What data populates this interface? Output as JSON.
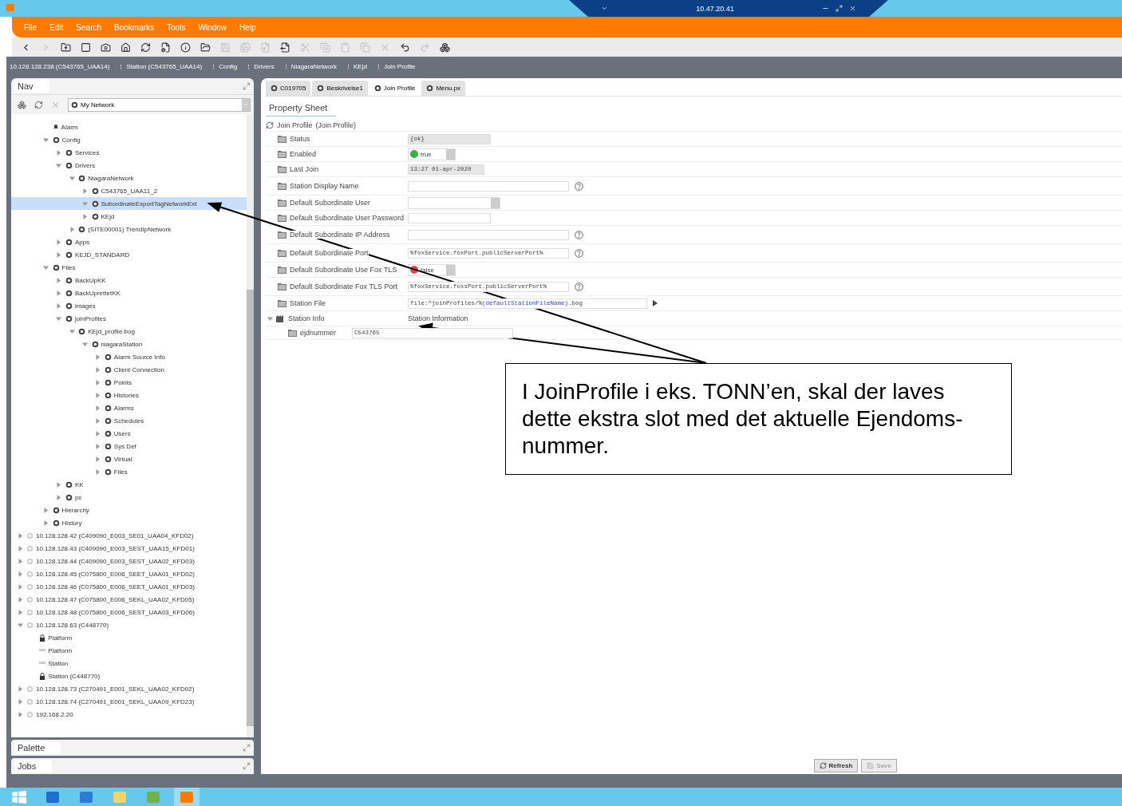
{
  "remote_bar": {
    "address": "10.47.20.41"
  },
  "menu": [
    "File",
    "Edit",
    "Search",
    "Bookmarks",
    "Tools",
    "Window",
    "Help"
  ],
  "toolbar": [
    {
      "disabled": false
    },
    {
      "disabled": true
    },
    {
      "disabled": false
    },
    {
      "disabled": false
    },
    {
      "disabled": false
    },
    {
      "disabled": false
    },
    {
      "disabled": false
    },
    {
      "disabled": false
    },
    {
      "disabled": false
    },
    {
      "disabled": false
    },
    {
      "disabled": true
    },
    {
      "disabled": true
    },
    {
      "disabled": true
    },
    {
      "disabled": false
    },
    {
      "disabled": true
    },
    {
      "disabled": true
    },
    {
      "disabled": true
    },
    {
      "disabled": true
    },
    {
      "disabled": true
    },
    {
      "disabled": false
    },
    {
      "disabled": true
    },
    {
      "disabled": false
    }
  ],
  "breadcrumb": [
    "10.128.128.238 (C543765_UAA14)",
    "Station (C543765_UAA14)",
    "Config",
    "Drivers",
    "NiagaraNetwork",
    "KEjd",
    "Join Profile"
  ],
  "nav": {
    "title": "Nav",
    "network": "My Network",
    "tree": [
      {
        "label": "Alarm",
        "kind": "leaf",
        "selected": false
      },
      {
        "label": "Config",
        "kind": "node",
        "expanded": true,
        "selected": false,
        "children": [
          {
            "label": "Services",
            "kind": "node",
            "expanded": false,
            "selected": false
          },
          {
            "label": "Drivers",
            "kind": "node",
            "expanded": true,
            "selected": false,
            "children": [
              {
                "label": "NiagaraNetwork",
                "kind": "node",
                "expanded": true,
                "selected": false,
                "children": [
                  {
                    "label": "C543765_UAA11_2",
                    "kind": "node",
                    "expanded": false,
                    "selected": false
                  },
                  {
                    "label": "SubordinateExportTagNetworkExt",
                    "kind": "node",
                    "expanded": true,
                    "selected": true
                  },
                  {
                    "label": "KEjd",
                    "kind": "node",
                    "expanded": false,
                    "selected": false
                  }
                ]
              },
              {
                "label": "(SITE00001) TrendIpNetwork",
                "kind": "node",
                "expanded": false,
                "selected": false
              }
            ]
          },
          {
            "label": "Apps",
            "kind": "node",
            "expanded": false,
            "selected": false
          },
          {
            "label": "KEJD_STANDARD",
            "kind": "node",
            "expanded": false,
            "selected": false
          }
        ]
      },
      {
        "label": "Files",
        "kind": "node",
        "expanded": true,
        "selected": false,
        "children": [
          {
            "label": "BackUpKK",
            "kind": "node",
            "expanded": false,
            "selected": false
          },
          {
            "label": "BackUprettetKK",
            "kind": "node",
            "expanded": false,
            "selected": false
          },
          {
            "label": "images",
            "kind": "node",
            "expanded": false,
            "selected": false
          },
          {
            "label": "joinProfiles",
            "kind": "node",
            "expanded": true,
            "selected": false,
            "children": [
              {
                "label": "KEjd_profile.bog",
                "kind": "node",
                "expanded": true,
                "selected": false,
                "children": [
                  {
                    "label": "niagaraStation",
                    "kind": "node",
                    "expanded": true,
                    "selected": false,
                    "children": [
                      {
                        "label": "Alarm Source Info",
                        "kind": "node",
                        "expanded": false,
                        "selected": false
                      },
                      {
                        "label": "Client Connection",
                        "kind": "node",
                        "expanded": false,
                        "selected": false
                      },
                      {
                        "label": "Points",
                        "kind": "node",
                        "expanded": false,
                        "selected": false
                      },
                      {
                        "label": "Histories",
                        "kind": "node",
                        "expanded": false,
                        "selected": false
                      },
                      {
                        "label": "Alarms",
                        "kind": "node",
                        "expanded": false,
                        "selected": false
                      },
                      {
                        "label": "Schedules",
                        "kind": "node",
                        "expanded": false,
                        "selected": false
                      },
                      {
                        "label": "Users",
                        "kind": "node",
                        "expanded": false,
                        "selected": false
                      },
                      {
                        "label": "Sys Def",
                        "kind": "node",
                        "expanded": false,
                        "selected": false
                      },
                      {
                        "label": "Virtual",
                        "kind": "node",
                        "expanded": false,
                        "selected": false
                      },
                      {
                        "label": "Files",
                        "kind": "node",
                        "expanded": false,
                        "selected": false
                      }
                    ]
                  }
                ]
              }
            ]
          },
          {
            "label": "KK",
            "kind": "node",
            "expanded": false,
            "selected": false
          },
          {
            "label": "px",
            "kind": "node",
            "expanded": false,
            "selected": false
          }
        ]
      },
      {
        "label": "Hierarchy",
        "kind": "node",
        "expanded": false,
        "selected": false
      },
      {
        "label": "History",
        "kind": "node",
        "expanded": false,
        "selected": false
      }
    ],
    "hosts": [
      {
        "label": "10.128.128.42 (C409090_E003_SE01_UAA04_KFD02)",
        "kind": "host",
        "expanded": false,
        "selected": false
      },
      {
        "label": "10.128.128.43 (C409090_E003_SEST_UAA15_KFD01)",
        "kind": "host",
        "expanded": false,
        "selected": false
      },
      {
        "label": "10.128.128.44 (C409090_E003_SEST_UAA02_KFD03)",
        "kind": "host",
        "expanded": false,
        "selected": false
      },
      {
        "label": "10.128.128.45 (C075800_E006_SEET_UAA01_KFD02)",
        "kind": "host",
        "expanded": false,
        "selected": false
      },
      {
        "label": "10.128.128.46 (C075800_E006_SEET_UAA01_KFD03)",
        "kind": "host",
        "expanded": false,
        "selected": false
      },
      {
        "label": "10.128.128.47 (C075800_E006_SEKL_UAA02_KFD05)",
        "kind": "host",
        "expanded": false,
        "selected": false
      },
      {
        "label": "10.128.128.48 (C075800_E006_SEST_UAA03_KFD06)",
        "kind": "host",
        "expanded": false,
        "selected": false
      },
      {
        "label": "10.128.128.63 (C448770)",
        "kind": "host",
        "expanded": true,
        "selected": false,
        "children": [
          {
            "label": "Platform",
            "kind": "leaf",
            "locked": true,
            "selected": false
          },
          {
            "label": "Platform",
            "kind": "leaf",
            "locked": false,
            "selected": false
          },
          {
            "label": "Station",
            "kind": "leaf",
            "locked": false,
            "selected": false
          },
          {
            "label": "Station (C448770)",
            "kind": "leaf",
            "locked": true,
            "selected": false
          }
        ]
      },
      {
        "label": "10.128.128.73 (C270491_E001_SEKL_UAA02_KFD02)",
        "kind": "host",
        "expanded": false,
        "selected": false
      },
      {
        "label": "10.128.128.74 (C270491_E001_SEKL_UAA09_KFD23)",
        "kind": "host",
        "expanded": false,
        "selected": false
      },
      {
        "label": "192.168.2.20",
        "kind": "host",
        "expanded": false,
        "selected": false
      }
    ]
  },
  "side_panels": [
    "Palette",
    "Jobs"
  ],
  "tabs": [
    {
      "label": "C019705",
      "selected": false
    },
    {
      "label": "Beskrivelse1",
      "selected": false
    },
    {
      "label": "Join Profile",
      "selected": true
    },
    {
      "label": "Menu.px",
      "selected": false
    }
  ],
  "view_tab": "Property Sheet",
  "component": {
    "name": "Join Profile",
    "type": "(Join Profile)"
  },
  "properties": [
    {
      "label": "Status",
      "kind": "readonly",
      "value": "{ok}",
      "help": false
    },
    {
      "label": "Enabled",
      "kind": "bool",
      "value": "true",
      "on": true,
      "help": false
    },
    {
      "label": "Last Join",
      "kind": "readonly",
      "value": "13:27 01-apr-2020",
      "help": false
    },
    {
      "label": "Station Display Name",
      "kind": "text",
      "help": true
    },
    {
      "label": "Default Subordinate User",
      "kind": "dropdown",
      "help": false
    },
    {
      "label": "Default Subordinate User Password",
      "kind": "text",
      "help": false
    },
    {
      "label": "Default Subordinate IP Address",
      "kind": "text",
      "help": true
    },
    {
      "label": "Default Subordinate Port",
      "kind": "text",
      "value": "%foxService.foxPort.publicServerPort%",
      "help": true
    },
    {
      "label": "Default Subordinate Use Fox TLS",
      "kind": "bool",
      "value": "false",
      "on": false,
      "help": false
    },
    {
      "label": "Default Subordinate Fox TLS Port",
      "kind": "text",
      "value": "%foxService.foxsPort.publicServerPort%",
      "help": true
    },
    {
      "label": "Station File",
      "kind": "file",
      "value_parts": [
        {
          "text": "file:^joinProfiles/%",
          "kind": "plain"
        },
        {
          "text": "(defaultStationFileName)",
          "kind": "slot"
        },
        {
          "text": ".bog",
          "kind": "plain"
        }
      ],
      "help": false
    },
    {
      "label": "Station Info",
      "kind": "folder",
      "value": "Station Information",
      "expanded": true,
      "help": false,
      "children": [
        {
          "label": "ejdnummer",
          "kind": "text",
          "value": "C543765"
        }
      ]
    }
  ],
  "buttons": [
    {
      "label": "Refresh",
      "disabled": false
    },
    {
      "label": "Save",
      "disabled": true
    }
  ],
  "taskbar": [
    {
      "selected": false
    },
    {
      "selected": false
    },
    {
      "selected": false
    },
    {
      "selected": false
    },
    {
      "selected": false
    },
    {
      "selected": true
    }
  ],
  "annotation": {
    "text": "I JoinProfile i eks. TONN’en, skal der laves dette ekstra slot med det aktuelle Ejendoms-nummer."
  }
}
